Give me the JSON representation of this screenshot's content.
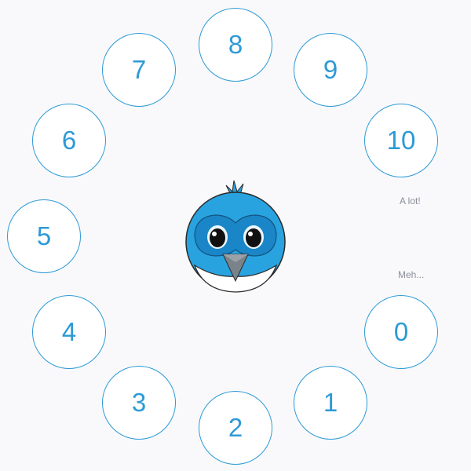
{
  "rating": {
    "buttons": [
      {
        "value": "0",
        "key": "0"
      },
      {
        "value": "1",
        "key": "1"
      },
      {
        "value": "2",
        "key": "2"
      },
      {
        "value": "3",
        "key": "3"
      },
      {
        "value": "4",
        "key": "4"
      },
      {
        "value": "5",
        "key": "5"
      },
      {
        "value": "6",
        "key": "6"
      },
      {
        "value": "7",
        "key": "7"
      },
      {
        "value": "8",
        "key": "8"
      },
      {
        "value": "9",
        "key": "9"
      },
      {
        "value": "10",
        "key": "10"
      }
    ],
    "hint_high": "A lot!",
    "hint_low": "Meh..."
  },
  "mascot": {
    "icon": "bird-mascot-icon"
  },
  "colors": {
    "accent": "#2d9ad6",
    "background": "#f9f9fb",
    "hint_text": "#8a8f98",
    "bird_body": "#29a3df",
    "bird_mask": "#1a86c7"
  }
}
